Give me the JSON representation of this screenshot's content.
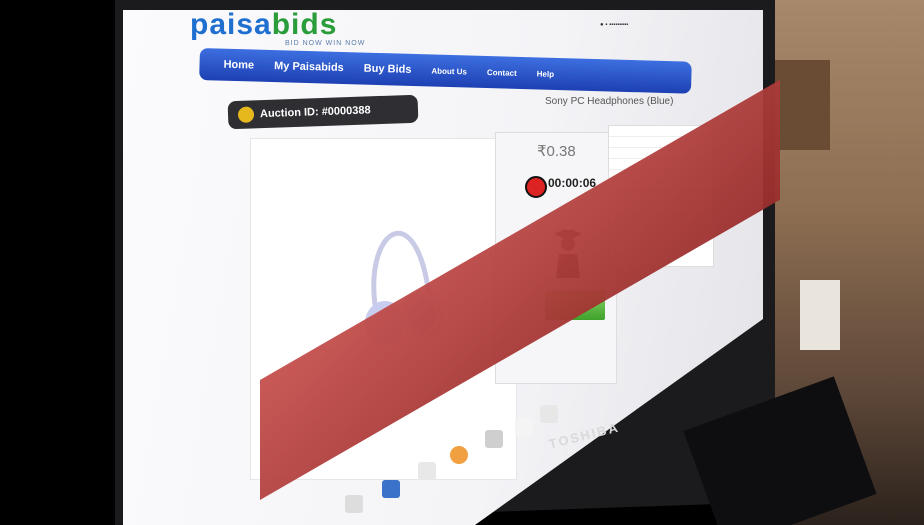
{
  "site": {
    "logo_part1": "paisa",
    "logo_part2": "bids",
    "tagline": "BID NOW   WIN NOW"
  },
  "nav": {
    "items": [
      "Home",
      "My Paisabids",
      "Buy Bids",
      "About Us",
      "Contact",
      "Help"
    ]
  },
  "auction": {
    "label": "Auction ID: #0000388",
    "product": "Sony PC Headphones (Blue)",
    "price": "₹0.38",
    "timer": "00:00:06"
  },
  "device": {
    "brand": "TOSHIBA"
  }
}
